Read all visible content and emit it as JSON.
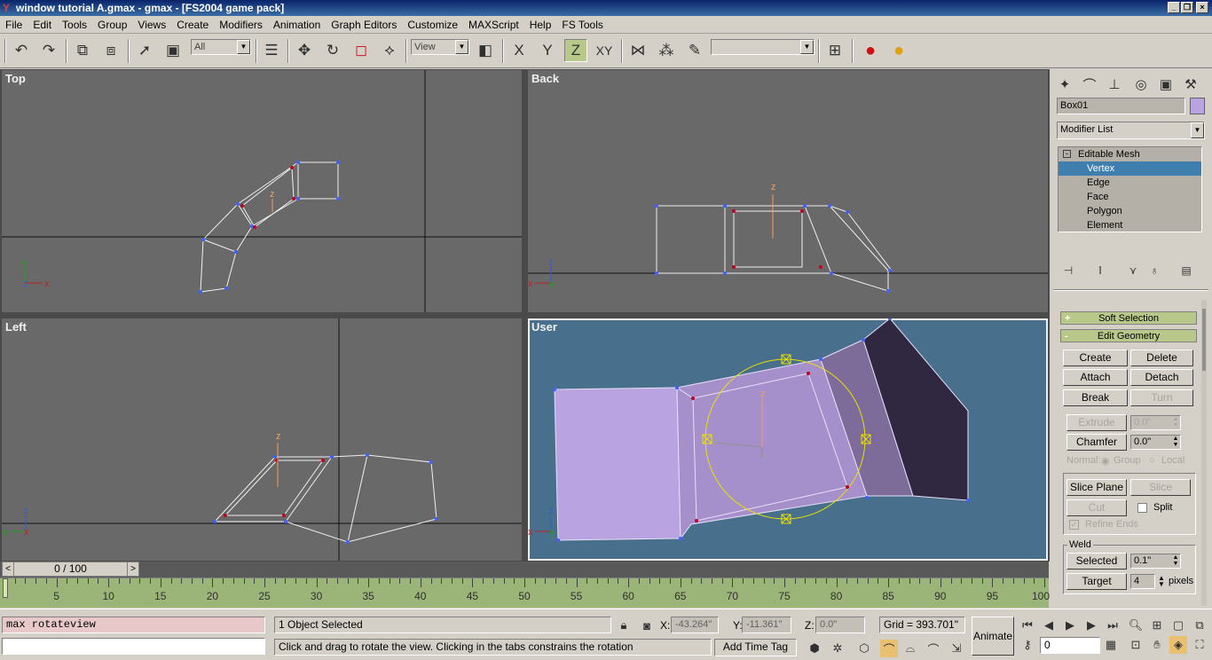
{
  "window": {
    "title": "window tutorial A.gmax - gmax - [FS2004 game pack]"
  },
  "menu": [
    "File",
    "Edit",
    "Tools",
    "Group",
    "Views",
    "Create",
    "Modifiers",
    "Animation",
    "Graph Editors",
    "Customize",
    "MAXScript",
    "Help",
    "FS Tools"
  ],
  "toolbar": {
    "selection_filter": "All",
    "ref_coord": "View",
    "axis_x": "X",
    "axis_y": "Y",
    "axis_z": "Z",
    "axis_xy": "XY",
    "named_selection": "",
    "icons": [
      "undo-icon",
      "redo-icon",
      "link-icon",
      "unlink-icon",
      "select-icon",
      "region-select-icon",
      "select-by-name-icon",
      "move-icon",
      "rotate-icon",
      "scale-icon",
      "snap-icon",
      "pivot-icon",
      "mirror-icon",
      "array-icon",
      "eraser-icon",
      "named-set-icon",
      "render-icon",
      "material-icon"
    ]
  },
  "viewports": {
    "top": {
      "label": "Top"
    },
    "back": {
      "label": "Back"
    },
    "left": {
      "label": "Left"
    },
    "user": {
      "label": "User"
    }
  },
  "axes": {
    "x": "x",
    "y": "y",
    "z": "z"
  },
  "command_panel": {
    "object_name": "Box01",
    "object_color": "#b9a3e0",
    "modifier_list": "Modifier List",
    "stack": [
      "Editable Mesh",
      "Vertex",
      "Edge",
      "Face",
      "Polygon",
      "Element"
    ],
    "selected_stack_item": "Vertex",
    "rollouts": {
      "soft_selection": "Soft Selection",
      "edit_geometry": "Edit Geometry",
      "plus": "+",
      "minus": "-"
    },
    "buttons": {
      "create": "Create",
      "delete": "Delete",
      "attach": "Attach",
      "detach": "Detach",
      "break": "Break",
      "turn": "Turn",
      "extrude": "Extrude",
      "chamfer": "Chamfer",
      "slice_plane": "Slice Plane",
      "slice": "Slice",
      "cut": "Cut",
      "selected": "Selected",
      "target": "Target"
    },
    "extrude_value": "0.0\"",
    "chamfer_value": "0.0\"",
    "normal_label": "Normal:",
    "group_label": "Group",
    "local_label": "Local",
    "split_label": "Split",
    "refine_ends_label": "Refine Ends",
    "weld_label": "Weld",
    "weld_selected_value": "0.1\"",
    "weld_target_value": "4",
    "pixels_label": "pixels"
  },
  "timeline": {
    "slider": "0 / 100",
    "prev": "<",
    "next": ">",
    "ticks": [
      "5",
      "10",
      "15",
      "20",
      "25",
      "30",
      "35",
      "40",
      "45",
      "50",
      "55",
      "60",
      "65",
      "70",
      "75",
      "80",
      "85",
      "90",
      "95",
      "100"
    ]
  },
  "status": {
    "script_line": "max rotateview",
    "selection": "1 Object Selected",
    "prompt": "Click and drag to rotate the view.  Clicking in the tabs constrains the rotation",
    "x_label": "X:",
    "x_value": "-43.264\"",
    "y_label": "Y:",
    "y_value": "-11.361\"",
    "z_label": "Z:",
    "z_value": "0.0\"",
    "grid": "Grid = 393.701\"",
    "add_time_tag": "Add Time Tag",
    "animate": "Animate",
    "frame": "0"
  }
}
